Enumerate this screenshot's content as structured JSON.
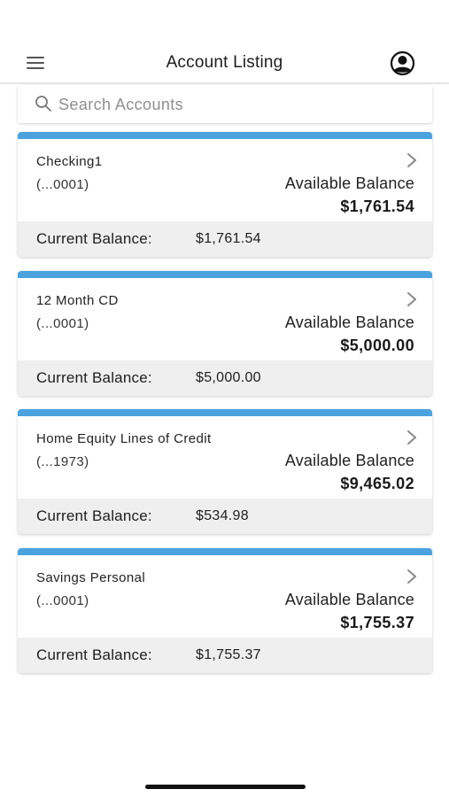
{
  "header": {
    "title": "Account Listing",
    "menu_icon": "hamburger-menu-icon",
    "profile_icon": "user-profile-icon"
  },
  "search": {
    "placeholder": "Search Accounts",
    "value": "",
    "icon": "search-icon"
  },
  "colors": {
    "accent": "#4aa3df",
    "footer_bg": "#efefef"
  },
  "accounts": [
    {
      "name": "Checking1",
      "number": "(...0001)",
      "available_label": "Available Balance",
      "available_balance": "$1,761.54",
      "current_label": "Current Balance:",
      "current_balance": "$1,761.54"
    },
    {
      "name": "12 Month CD",
      "number": "(...0001)",
      "available_label": "Available Balance",
      "available_balance": "$5,000.00",
      "current_label": "Current Balance:",
      "current_balance": "$5,000.00"
    },
    {
      "name": "Home Equity Lines of Credit",
      "number": "(...1973)",
      "available_label": "Available Balance",
      "available_balance": "$9,465.02",
      "current_label": "Current Balance:",
      "current_balance": "$534.98"
    },
    {
      "name": "Savings Personal",
      "number": "(...0001)",
      "available_label": "Available Balance",
      "available_balance": "$1,755.37",
      "current_label": "Current Balance:",
      "current_balance": "$1,755.37"
    }
  ]
}
